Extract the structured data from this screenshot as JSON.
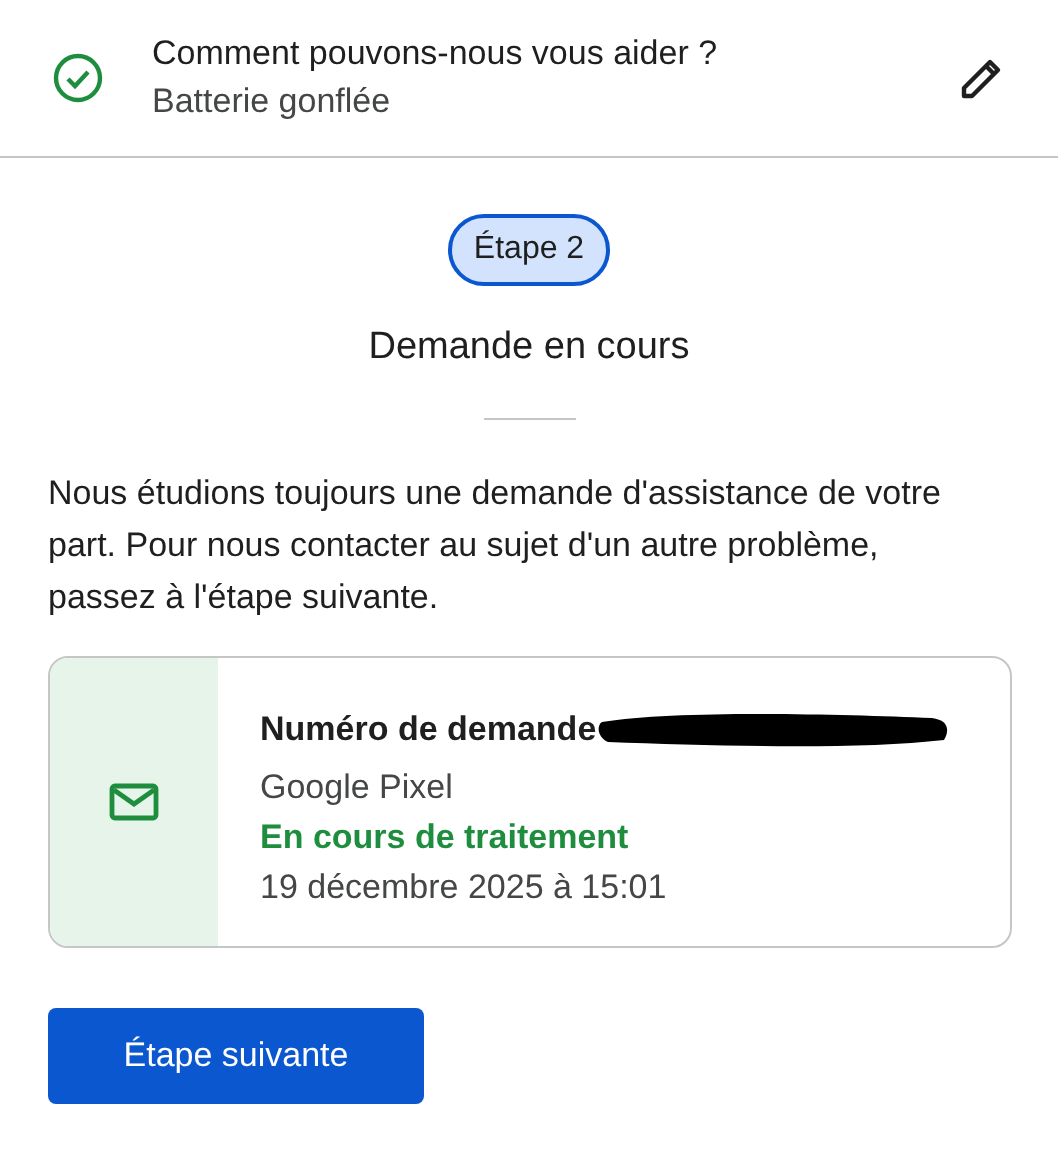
{
  "header": {
    "title": "Comment pouvons-nous vous aider ?",
    "subtitle": "Batterie gonflée",
    "completed": true
  },
  "step": {
    "label": "Étape 2"
  },
  "heading": "Demande en cours",
  "message": "Nous étudions toujours une demande d'assistance de votre part. Pour nous contacter au sujet d'un autre problème, passez à l'étape suivante.",
  "request_card": {
    "title": "Numéro de demande",
    "device": "Google Pixel",
    "status": "En cours de traitement",
    "date": "19 décembre 2025 à 15:01"
  },
  "buttons": [
    "Étape suivante"
  ]
}
